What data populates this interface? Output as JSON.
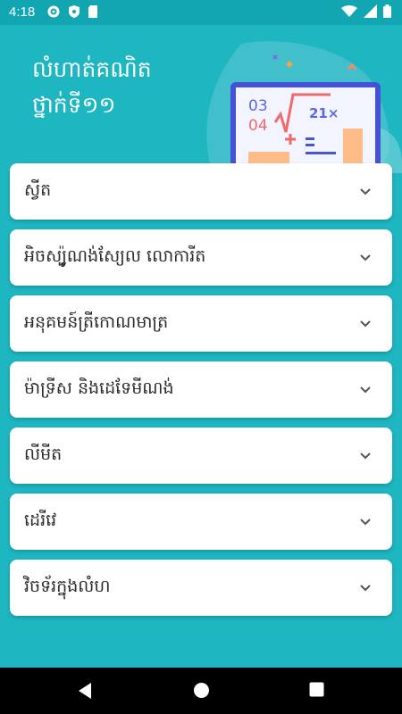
{
  "status_bar": {
    "time": "4:18",
    "icons_left": [
      "gear-icon",
      "shield-icon",
      "sd-card-icon"
    ],
    "icons_right": [
      "wifi-icon",
      "signal-icon",
      "battery-icon"
    ]
  },
  "header": {
    "title_line1": "លំហាត់គណិត",
    "title_line2": "ថ្នាក់ទី១១",
    "illustration_text": {
      "top_left": "03",
      "bottom_left": "04",
      "formula": "21×"
    }
  },
  "topics": [
    {
      "label": "ស្វីត"
    },
    {
      "label": "អិចស្ប៉ូណង់ស្យែល លោការីត"
    },
    {
      "label": "អនុគមន៍ត្រីកោណមាត្រ"
    },
    {
      "label": "ម៉ាទ្រីស និងដេទែមីណង់"
    },
    {
      "label": "លីមីត"
    },
    {
      "label": "ដេរីវេ"
    },
    {
      "label": "វិចទ័រក្នុងលំហ"
    }
  ],
  "colors": {
    "background": "#1db6c1",
    "status_bar": "#11a6b1",
    "card": "#ffffff",
    "nav_bar": "#000000"
  }
}
